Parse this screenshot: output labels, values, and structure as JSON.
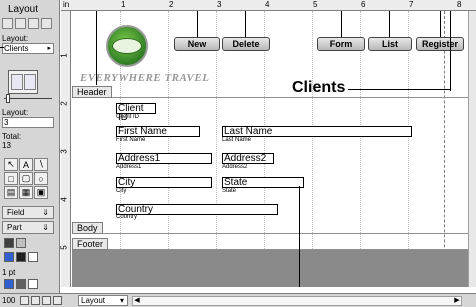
{
  "status_area": {
    "mode": "Layout",
    "layout_label": "Layout:",
    "layout_popup": "Clients",
    "layout_field_label": "Layout:",
    "layout_number": "3",
    "total_label": "Total:",
    "total_value": "13",
    "field_button": "Field",
    "part_button": "Part",
    "line_width": "1 pt"
  },
  "ruler": {
    "unit": "in",
    "top_numbers": [
      "1",
      "2",
      "3",
      "4",
      "5",
      "6",
      "7",
      "8"
    ],
    "left_numbers": [
      "1",
      "2",
      "3",
      "4",
      "5"
    ]
  },
  "layout": {
    "brand": "EVERYWHERE TRAVEL",
    "title": "Clients",
    "buttons": [
      "New",
      "Delete",
      "Form",
      "List",
      "Register"
    ],
    "parts": {
      "header": "Header",
      "body": "Body",
      "footer": "Footer"
    },
    "fields": [
      {
        "name": "Client ID",
        "label": "Client ID"
      },
      {
        "name": "First Name",
        "label": "First Name"
      },
      {
        "name": "Last Name",
        "label": "Last Name"
      },
      {
        "name": "Address1",
        "label": "Address1"
      },
      {
        "name": "Address2",
        "label": "Address2"
      },
      {
        "name": "City",
        "label": "City"
      },
      {
        "name": "State",
        "label": "State"
      },
      {
        "name": "Country",
        "label": "Country"
      }
    ]
  },
  "bottom_bar": {
    "zoom": "100",
    "mode_popup": "Layout"
  }
}
